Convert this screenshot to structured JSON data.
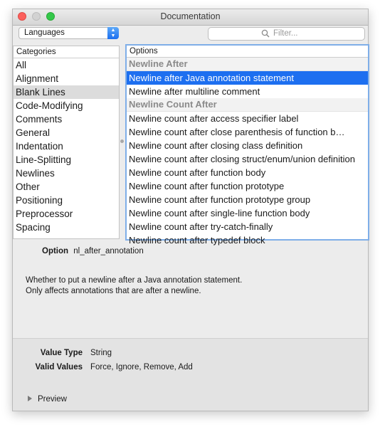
{
  "window": {
    "title": "Documentation"
  },
  "toolbar": {
    "language_select": "Languages",
    "filter_placeholder": "Filter..."
  },
  "categories": {
    "header": "Categories",
    "items": [
      "All",
      "Alignment",
      "Blank Lines",
      "Code-Modifying",
      "Comments",
      "General",
      "Indentation",
      "Line-Splitting",
      "Newlines",
      "Other",
      "Positioning",
      "Preprocessor",
      "Spacing"
    ],
    "selected": "Blank Lines"
  },
  "options": {
    "header": "Options",
    "items": [
      {
        "label": "Newline After",
        "type": "group"
      },
      {
        "label": "Newline after Java annotation statement",
        "type": "item",
        "selected": true
      },
      {
        "label": "Newline after multiline comment",
        "type": "item"
      },
      {
        "label": "Newline Count After",
        "type": "group"
      },
      {
        "label": "Newline count after access specifier label",
        "type": "item"
      },
      {
        "label": "Newline count after close parenthesis of function b…",
        "type": "item"
      },
      {
        "label": "Newline count after closing class definition",
        "type": "item"
      },
      {
        "label": "Newline count after closing struct/enum/union definition",
        "type": "item"
      },
      {
        "label": "Newline count after function body",
        "type": "item"
      },
      {
        "label": "Newline count after function prototype",
        "type": "item"
      },
      {
        "label": "Newline count after function prototype group",
        "type": "item"
      },
      {
        "label": "Newline count after single-line function body",
        "type": "item"
      },
      {
        "label": "Newline count after try-catch-finally",
        "type": "item"
      },
      {
        "label": "Newline count after typedef block",
        "type": "item"
      }
    ]
  },
  "detail": {
    "option_label": "Option",
    "option_name": "nl_after_annotation",
    "description_line1": "Whether to put a newline after a Java annotation statement.",
    "description_line2": "Only affects annotations that are after a newline."
  },
  "bottom": {
    "value_type_label": "Value Type",
    "value_type": "String",
    "valid_values_label": "Valid Values",
    "valid_values": "Force, Ignore, Remove, Add",
    "preview_label": "Preview"
  },
  "colors": {
    "selection": "#1d6ff0",
    "accent": "#7faee8"
  }
}
